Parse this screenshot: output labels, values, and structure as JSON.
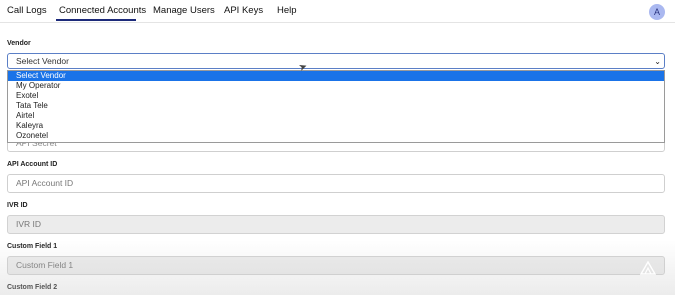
{
  "nav": {
    "items": [
      {
        "label": "Call Logs"
      },
      {
        "label": "Connected Accounts"
      },
      {
        "label": "Manage Users"
      },
      {
        "label": "API Keys"
      },
      {
        "label": "Help"
      }
    ],
    "active": "Connected Accounts",
    "avatar_initial": "A"
  },
  "vendor": {
    "label": "Vendor",
    "selected": "Select Vendor",
    "options": [
      "Select Vendor",
      "My Operator",
      "Exotel",
      "Tata Tele",
      "Airtel",
      "Kaleyra",
      "Ozonetel"
    ]
  },
  "api_secret": {
    "placeholder": "API Secret"
  },
  "api_account_id": {
    "label": "API Account ID",
    "placeholder": "API Account ID"
  },
  "ivr_id": {
    "label": "IVR ID",
    "placeholder": "IVR ID"
  },
  "custom_field_1": {
    "label": "Custom Field 1",
    "placeholder": "Custom Field 1"
  },
  "custom_field_2": {
    "label": "Custom Field 2"
  },
  "colors": {
    "accent": "#1c2a7a",
    "selected_option": "#1a73e8",
    "avatar_bg": "#aab8f0"
  }
}
